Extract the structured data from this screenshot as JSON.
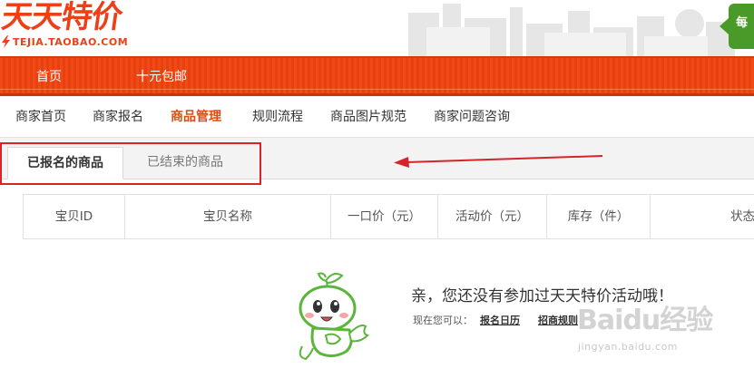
{
  "header": {
    "logo_title": "天天特价",
    "logo_url": "TEJIA.TAOBAO.COM",
    "badge_char": "每"
  },
  "top_nav": {
    "items": [
      {
        "label": "首页"
      },
      {
        "label": "十元包邮"
      }
    ]
  },
  "merchant_nav": {
    "items": [
      {
        "label": "商家首页"
      },
      {
        "label": "商家报名"
      },
      {
        "label": "商品管理",
        "active": true
      },
      {
        "label": "规则流程"
      },
      {
        "label": "商品图片规范"
      },
      {
        "label": "商家问题咨询"
      }
    ]
  },
  "tabs": [
    {
      "label": "已报名的商品",
      "active": true
    },
    {
      "label": "已结束的商品",
      "active": false
    }
  ],
  "table": {
    "columns": [
      "宝贝ID",
      "宝贝名称",
      "一口价（元）",
      "活动价（元）",
      "库存（件）",
      "状态"
    ]
  },
  "empty_state": {
    "message": "亲，您还没有参加过天天特价活动哦！",
    "prefix": "现在您可以：",
    "links": [
      "报名日历",
      "招商规则"
    ]
  },
  "watermark": {
    "mark": "Baidu经验",
    "url": "jingyan.baidu.com"
  },
  "colors": {
    "brand_orange": "#f04a17",
    "active_menu": "#e24a12",
    "annotation_red": "#d8232a",
    "mascot_green": "#5bb53a"
  }
}
